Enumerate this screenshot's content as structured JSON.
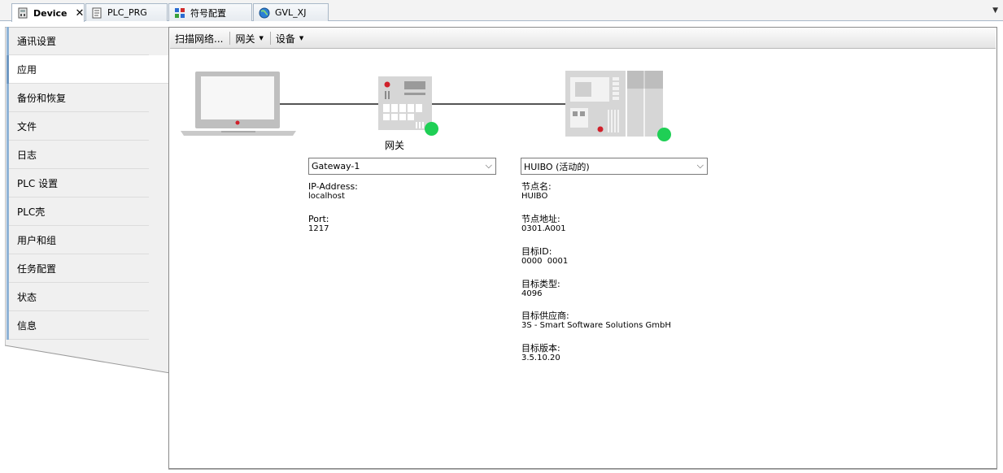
{
  "tabs": [
    {
      "label": "Device",
      "icon": "device-icon"
    },
    {
      "label": "PLC_PRG",
      "icon": "document-icon"
    },
    {
      "label": "符号配置",
      "icon": "symbol-config-icon"
    },
    {
      "label": "GVL_XJ",
      "icon": "globe-icon"
    }
  ],
  "tab_close": "✕",
  "tab_dropdown": "▼",
  "sidebar": {
    "items": [
      {
        "label": "通讯设置"
      },
      {
        "label": "应用"
      },
      {
        "label": "备份和恢复"
      },
      {
        "label": "文件"
      },
      {
        "label": "日志"
      },
      {
        "label": "PLC 设置"
      },
      {
        "label": "PLC壳"
      },
      {
        "label": "用户和组"
      },
      {
        "label": "任务配置"
      },
      {
        "label": "状态"
      },
      {
        "label": "信息"
      }
    ]
  },
  "toolbar": {
    "scan_label": "扫描网络...",
    "gateway_label": "网关",
    "device_label": "设备"
  },
  "gateway": {
    "title": "网关",
    "selected": "Gateway-1",
    "ip_label": "IP-Address:",
    "ip_value": "localhost",
    "port_label": "Port:",
    "port_value": "1217"
  },
  "device": {
    "selected": "HUIBO (活动的)",
    "fields": [
      {
        "label": "节点名:",
        "value": "HUIBO"
      },
      {
        "label": "节点地址:",
        "value": "0301.A001"
      },
      {
        "label": "目标ID:",
        "value": "0000  0001"
      },
      {
        "label": "目标类型:",
        "value": "4096"
      },
      {
        "label": "目标供应商:",
        "value": "3S - Smart Software Solutions GmbH"
      },
      {
        "label": "目标版本:",
        "value": "3.5.10.20"
      }
    ]
  },
  "colors": {
    "status_online": "#1fcf55",
    "indicator_red": "#d0202a",
    "sidebar_accent": "#8fb3d6"
  }
}
